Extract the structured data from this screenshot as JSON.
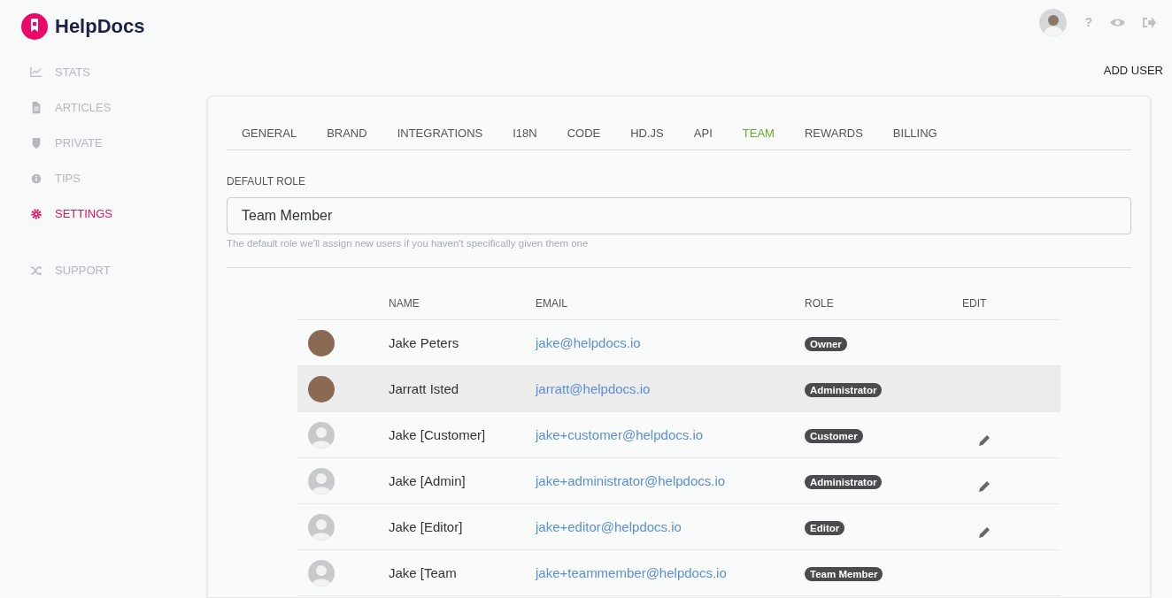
{
  "brand": {
    "name": "HelpDocs"
  },
  "sidebar": {
    "items": [
      {
        "label": "STATS",
        "selected": false
      },
      {
        "label": "ARTICLES",
        "selected": false
      },
      {
        "label": "PRIVATE",
        "selected": false
      },
      {
        "label": "TIPS",
        "selected": false
      },
      {
        "label": "SETTINGS",
        "selected": true
      },
      {
        "label": "SUPPORT",
        "selected": false
      }
    ]
  },
  "header": {
    "help": "?"
  },
  "add_user": "ADD USER",
  "tabs": [
    {
      "label": "GENERAL",
      "selected": false
    },
    {
      "label": "BRAND",
      "selected": false
    },
    {
      "label": "INTEGRATIONS",
      "selected": false
    },
    {
      "label": "I18N",
      "selected": false
    },
    {
      "label": "CODE",
      "selected": false
    },
    {
      "label": "HD.JS",
      "selected": false
    },
    {
      "label": "API",
      "selected": false
    },
    {
      "label": "TEAM",
      "selected": true
    },
    {
      "label": "REWARDS",
      "selected": false
    },
    {
      "label": "BILLING",
      "selected": false
    }
  ],
  "default_role": {
    "label": "DEFAULT ROLE",
    "value": "Team Member",
    "help": "The default role we'll assign new users if you haven't specifically given them one"
  },
  "table": {
    "columns": [
      "NAME",
      "EMAIL",
      "ROLE",
      "EDIT"
    ],
    "rows": [
      {
        "kind": "photo",
        "name": "Jake Peters",
        "email": "jake@helpdocs.io",
        "role": "Owner",
        "editable": false,
        "hovered": false
      },
      {
        "kind": "photo",
        "name": "Jarratt Isted",
        "email": "jarratt@helpdocs.io",
        "role": "Administrator",
        "editable": false,
        "hovered": true
      },
      {
        "kind": "default",
        "name": "Jake [Customer]",
        "email": "jake+customer@helpdocs.io",
        "role": "Customer",
        "editable": true,
        "hovered": false
      },
      {
        "kind": "default",
        "name": "Jake [Admin]",
        "email": "jake+administrator@helpdocs.io",
        "role": "Administrator",
        "editable": true,
        "hovered": false
      },
      {
        "kind": "default",
        "name": "Jake [Editor]",
        "email": "jake+editor@helpdocs.io",
        "role": "Editor",
        "editable": true,
        "hovered": false
      },
      {
        "kind": "default",
        "name": "Jake [Team",
        "email": "jake+teammember@helpdocs.io",
        "role": "Team Member",
        "editable": false,
        "hovered": false
      }
    ]
  }
}
